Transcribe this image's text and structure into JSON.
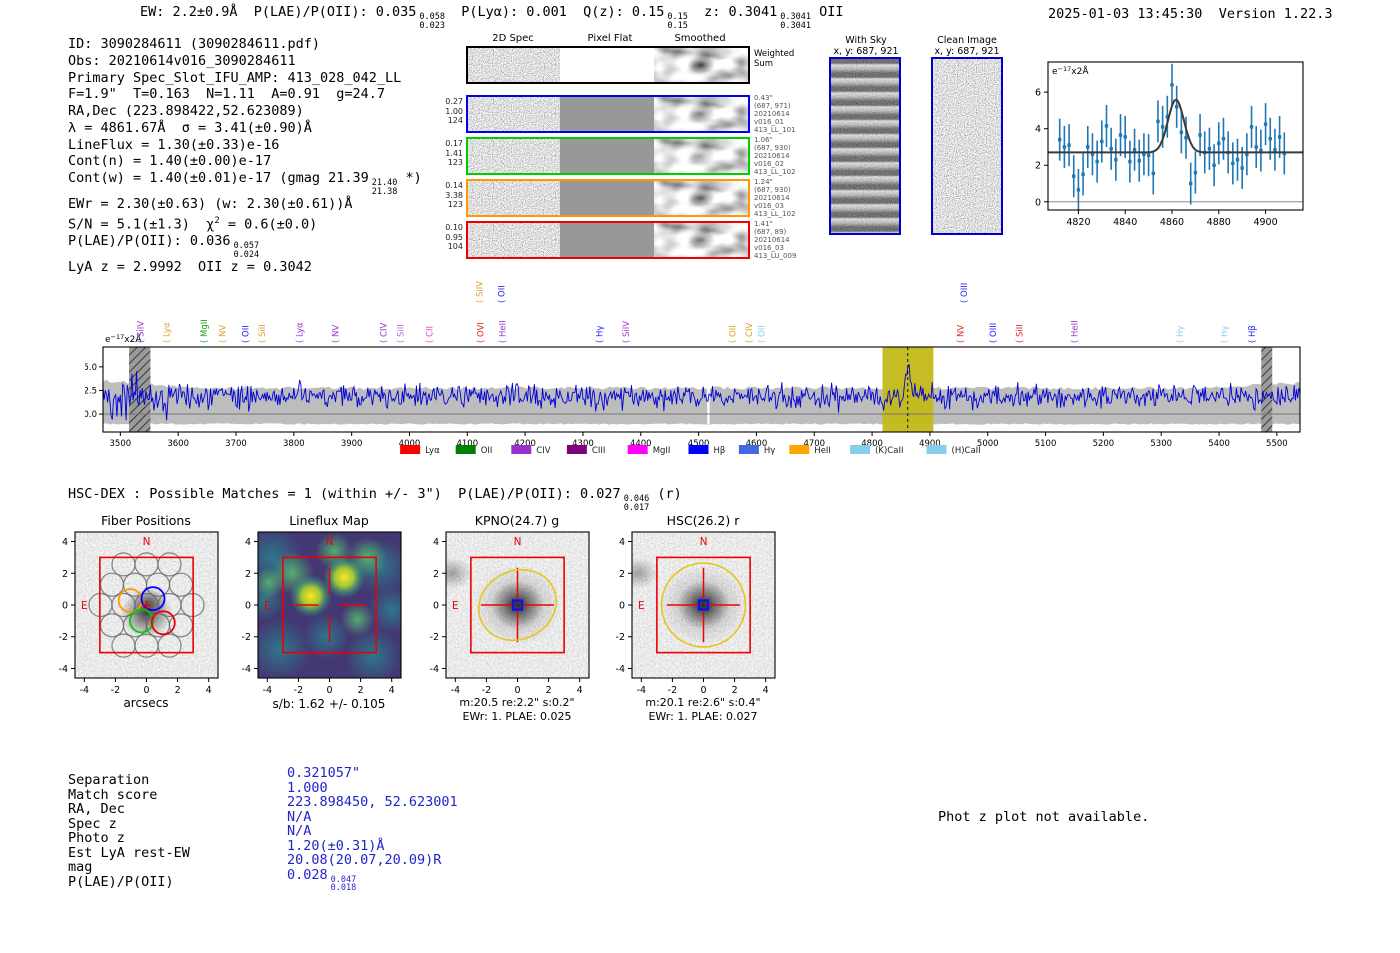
{
  "header": {
    "summary_segments": [
      {
        "t": "EW: 2.2±0.9Å  P(LAE)/P(OII): 0.035"
      },
      {
        "f": [
          "0.058",
          "0.023"
        ]
      },
      {
        "t": "  P(Lyα): 0.001  Q(z): 0.15"
      },
      {
        "f": [
          "0.15",
          "0.15"
        ]
      },
      {
        "t": "  z: 0.3041"
      },
      {
        "f": [
          "0.3041",
          "0.3041"
        ]
      },
      {
        "t": " OII"
      }
    ],
    "timestamp": "2025-01-03 13:45:30",
    "version": "Version 1.22.3"
  },
  "detection_info": {
    "lines": [
      [
        {
          "t": "ID: 3090284611 (3090284611.pdf)"
        }
      ],
      [
        {
          "t": "Obs: 20210614v016_3090284611"
        }
      ],
      [
        {
          "t": "Primary Spec_Slot_IFU_AMP: 413_028_042_LL"
        }
      ],
      [
        {
          "t": "F=1.9\"  T=0.163  N=1.11  A=0.91  g=24.7"
        }
      ],
      [
        {
          "t": "RA,Dec (223.898422,52.623089)"
        }
      ],
      [
        {
          "t": "λ = 4861.67Å  σ = 3.41(±0.90)Å"
        }
      ],
      [
        {
          "t": "LineFlux = 1.30(±0.33)e-16"
        }
      ],
      [
        {
          "t": "Cont(n) = 1.40(±0.00)e-17"
        }
      ],
      [
        {
          "t": "Cont(w) = 1.40(±0.01)e-17 (gmag 21.39"
        },
        {
          "f": [
            "21.40",
            "21.38"
          ]
        },
        {
          "t": " *)"
        }
      ],
      [
        {
          "t": "EWr = 2.30(±0.63) (w: 2.30(±0.61))Å"
        }
      ],
      [
        {
          "t": "S/N = 5.1(±1.3)  χ"
        },
        {
          "sup": "2"
        },
        {
          "t": " = 0.6(±0.0)"
        }
      ],
      [
        {
          "t": "P(LAE)/P(OII): 0.036"
        },
        {
          "f": [
            "0.057",
            "0.024"
          ]
        }
      ],
      [
        {
          "t": "LyA z = 2.9992  OII z = 0.3042"
        }
      ]
    ]
  },
  "spec2d": {
    "col_titles": [
      "2D Spec",
      "Pixel Flat",
      "Smoothed"
    ],
    "weighted_label": [
      "Weighted",
      "Sum"
    ],
    "rows": [
      {
        "color": "#0000ee",
        "left": [
          "0.27",
          "1.00",
          "124"
        ],
        "right": [
          "0.43\"",
          "(687, 971)",
          "20210614",
          "v016_01",
          "413_LL_101"
        ]
      },
      {
        "color": "#00cc00",
        "left": [
          "0.17",
          "1.41",
          "123"
        ],
        "right": [
          "1.06\"",
          "(687, 930)",
          "20210614",
          "v016_02",
          "413_LL_102"
        ]
      },
      {
        "color": "#ff9900",
        "left": [
          "0.14",
          "3.38",
          "123"
        ],
        "right": [
          "1.24\"",
          "(687, 930)",
          "20210614",
          "v016_03",
          "413_LL_102"
        ]
      },
      {
        "color": "#ee0000",
        "left": [
          "0.10",
          "0.95",
          "104"
        ],
        "right": [
          "1.41\"",
          "(687, 89)",
          "20210614",
          "v016_03",
          "413_LU_009"
        ]
      }
    ]
  },
  "panels": {
    "border_color": "#0000cc",
    "with_sky": {
      "title": "With Sky",
      "coords": "x, y: 687, 921"
    },
    "clean": {
      "title": "Clean Image",
      "coords": "x, y: 687, 921"
    }
  },
  "hsc_dex": {
    "segments": [
      {
        "t": "HSC-DEX : Possible Matches = 1 (within +/- 3\")  P(LAE)/P(OII): 0.027"
      },
      {
        "f": [
          "0.046",
          "0.017"
        ]
      },
      {
        "t": " (r)"
      }
    ]
  },
  "match_table": {
    "value_color": "#2323cc",
    "rows": [
      {
        "label": "Separation",
        "value": [
          {
            "t": "0.321057\""
          }
        ]
      },
      {
        "label": "Match score",
        "value": [
          {
            "t": "1.000"
          }
        ]
      },
      {
        "label": "RA, Dec",
        "value": [
          {
            "t": "223.898450, 52.623001"
          }
        ]
      },
      {
        "label": "Spec z",
        "value": [
          {
            "t": "N/A"
          }
        ]
      },
      {
        "label": "Photo z",
        "value": [
          {
            "t": "N/A"
          }
        ]
      },
      {
        "label": "Est LyA rest-EW",
        "value": [
          {
            "t": "1.20(±0.31)Å"
          }
        ]
      },
      {
        "label": "mag",
        "value": [
          {
            "t": "20.08(20.07,20.09)R"
          }
        ]
      },
      {
        "label": "P(LAE)/P(OII)",
        "value": [
          {
            "t": "0.028"
          },
          {
            "f": [
              "0.047",
              "0.018"
            ]
          }
        ]
      }
    ]
  },
  "footer": {
    "note": "Phot z plot not available."
  },
  "chart_data": [
    {
      "name": "line_fit_plot",
      "type": "scatter",
      "corner_label": {
        "pre": "e",
        "exp": "−17",
        "post": "x2Å"
      },
      "xlim": [
        4807,
        4916
      ],
      "ylim": [
        -0.45,
        7.65
      ],
      "xticks": [
        4820,
        4840,
        4860,
        4880,
        4900
      ],
      "yticks": [
        0,
        2,
        4,
        6
      ],
      "x": [
        4812,
        4814,
        4816,
        4818,
        4820,
        4822,
        4824,
        4826,
        4828,
        4830,
        4832,
        4834,
        4836,
        4838,
        4840,
        4842,
        4844,
        4846,
        4848,
        4850,
        4852,
        4854,
        4856,
        4858,
        4860,
        4862,
        4864,
        4866,
        4868,
        4870,
        4872,
        4874,
        4876,
        4878,
        4880,
        4882,
        4884,
        4886,
        4888,
        4890,
        4892,
        4894,
        4896,
        4898,
        4900,
        4902,
        4904,
        4906,
        4908
      ],
      "y": [
        3.4,
        3.0,
        3.1,
        1.4,
        0.65,
        1.5,
        3.0,
        2.6,
        2.2,
        3.3,
        4.15,
        2.9,
        2.3,
        3.65,
        3.55,
        2.2,
        2.85,
        2.25,
        2.6,
        2.55,
        1.55,
        4.4,
        4.1,
        4.65,
        6.4,
        5.2,
        3.8,
        3.5,
        1.0,
        1.6,
        3.65,
        2.7,
        2.9,
        2.0,
        3.2,
        3.45,
        2.7,
        2.1,
        2.3,
        1.85,
        2.6,
        4.1,
        3.0,
        2.8,
        4.25,
        3.45,
        2.85,
        3.55,
        2.65
      ],
      "yerr": 1.15,
      "fit": {
        "baseline": 2.7,
        "amplitude": 2.9,
        "center": 4861.7,
        "sigma": 3.4
      },
      "point_color": "#1f77b4",
      "fit_color": "#3a3a3a"
    },
    {
      "name": "full_spectrum",
      "type": "line",
      "corner_label": {
        "pre": "e",
        "exp": "−17",
        "post": "x2Å"
      },
      "xlim": [
        3470,
        5540
      ],
      "ylim": [
        -1.9,
        7.1
      ],
      "xticks": [
        3500,
        3600,
        3700,
        3800,
        3900,
        4000,
        4100,
        4200,
        4300,
        4400,
        4500,
        4600,
        4700,
        4800,
        4900,
        5000,
        5100,
        5200,
        5300,
        5400,
        5500
      ],
      "yticks": [
        0.0,
        2.5,
        5.0
      ],
      "line_color": "#0000d8",
      "spectrum": {
        "baseline": 1.85,
        "noise_sigma": 0.95,
        "edge_noise_boost": 2.0,
        "peak": {
          "center": 4861.7,
          "amplitude": 3.3,
          "sigma": 3.3
        }
      },
      "error_band": {
        "top": 2.75,
        "bottom": -1.05,
        "color": "#bdbdbd"
      },
      "highlight_band": {
        "x0": 4818,
        "x1": 4906,
        "color": "#c3b918"
      },
      "marker_line": {
        "x": 4861.67,
        "color": "#111111"
      },
      "hatch_bands": [
        [
          3515,
          3552
        ],
        [
          5473,
          5492
        ]
      ],
      "gap_x": 4517,
      "line_labels": [
        {
          "label": "SiIV",
          "color": "#9932cc",
          "wave": 3540,
          "row": "low"
        },
        {
          "label": "Lyα",
          "color": "#dd9f2b",
          "wave": 3585,
          "row": "low"
        },
        {
          "label": "MgII",
          "color": "#1e9e1e",
          "wave": 3650,
          "row": "low"
        },
        {
          "label": "NV",
          "color": "#dd9f2b",
          "wave": 3682,
          "row": "low"
        },
        {
          "label": "OII",
          "color": "#2222ee",
          "wave": 3722,
          "row": "low"
        },
        {
          "label": "SiII",
          "color": "#dd9f2b",
          "wave": 3750,
          "row": "low"
        },
        {
          "label": "Lyα",
          "color": "#9932cc",
          "wave": 3815,
          "row": "low"
        },
        {
          "label": "NV",
          "color": "#9932cc",
          "wave": 3877,
          "row": "low"
        },
        {
          "label": "CIV",
          "color": "#9932cc",
          "wave": 3960,
          "row": "low"
        },
        {
          "label": "SiII",
          "color": "#b06fd8",
          "wave": 3990,
          "row": "low"
        },
        {
          "label": "CII",
          "color": "#ee44cc",
          "wave": 4040,
          "row": "low"
        },
        {
          "label": "SiIV",
          "color": "#dd9f2b",
          "wave": 4126,
          "row": "high"
        },
        {
          "label": "OII",
          "color": "#2222ee",
          "wave": 4164,
          "row": "high"
        },
        {
          "label": "OVI",
          "color": "#dd2222",
          "wave": 4128,
          "row": "low"
        },
        {
          "label": "HeII",
          "color": "#9932cc",
          "wave": 4166,
          "row": "low"
        },
        {
          "label": "Hγ",
          "color": "#2222ee",
          "wave": 4334,
          "row": "low"
        },
        {
          "label": "SiIV",
          "color": "#9932cc",
          "wave": 4380,
          "row": "low"
        },
        {
          "label": "OII",
          "color": "#dd9f2b",
          "wave": 4564,
          "row": "low"
        },
        {
          "label": "CIV",
          "color": "#dd9f2b",
          "wave": 4592,
          "row": "low"
        },
        {
          "label": "OII",
          "color": "#86ceea",
          "wave": 4614,
          "row": "low"
        },
        {
          "label": "OIII",
          "color": "#2222ee",
          "wave": 4964,
          "row": "high"
        },
        {
          "label": "NV",
          "color": "#dd2222",
          "wave": 4958,
          "row": "low"
        },
        {
          "label": "OIII",
          "color": "#2222ee",
          "wave": 5014,
          "row": "low"
        },
        {
          "label": "SiII",
          "color": "#dd2222",
          "wave": 5060,
          "row": "low"
        },
        {
          "label": "HeII",
          "color": "#9932cc",
          "wave": 5155,
          "row": "low"
        },
        {
          "label": "Hγ",
          "color": "#86ceea",
          "wave": 5338,
          "row": "low"
        },
        {
          "label": "Hγ",
          "color": "#86ceea",
          "wave": 5415,
          "row": "low"
        },
        {
          "label": "Hβ",
          "color": "#2222ee",
          "wave": 5462,
          "row": "low"
        }
      ],
      "legend": [
        {
          "label": "Lyα",
          "color": "#ff0000"
        },
        {
          "label": "OII",
          "color": "#008000"
        },
        {
          "label": "CIV",
          "color": "#9932cc"
        },
        {
          "label": "CIII",
          "color": "#800080"
        },
        {
          "label": "MgII",
          "color": "#ff00ff"
        },
        {
          "label": "Hβ",
          "color": "#0000ff"
        },
        {
          "label": "Hγ",
          "color": "#4169e1"
        },
        {
          "label": "HeII",
          "color": "#ffa500"
        },
        {
          "label": "(K)CaII",
          "color": "#87ceeb"
        },
        {
          "label": "(H)CaII",
          "color": "#87ceeb"
        }
      ]
    },
    {
      "name": "fiber_positions",
      "type": "image",
      "title": "Fiber Positions",
      "xlabel": "arcsecs",
      "ticks": [
        -4,
        -2,
        0,
        2,
        4
      ],
      "lim": [
        -4.6,
        4.6
      ],
      "compass_n": "N",
      "compass_e": "E",
      "aperture_box": [
        -3,
        3
      ],
      "fibers": {
        "spacing": 1.48,
        "radius": 0.74
      },
      "colored_fibers": [
        {
          "color": "#ff9900",
          "x": -1.05,
          "y": 0.28
        },
        {
          "color": "#0000ff",
          "x": 0.42,
          "y": 0.4
        },
        {
          "color": "#00cc00",
          "x": -0.32,
          "y": -1.0
        },
        {
          "color": "#ee0000",
          "x": 1.08,
          "y": -1.12
        }
      ]
    },
    {
      "name": "lineflux_map",
      "type": "image",
      "title": "Lineflux Map",
      "sublabel": "s/b: 1.62 +/- 0.105",
      "ticks": [
        -4,
        -2,
        0,
        2,
        4
      ],
      "lim": [
        -4.6,
        4.6
      ],
      "compass_n": "N",
      "compass_e": "E",
      "aperture_box": [
        -3,
        3
      ],
      "hotspots": [
        {
          "x": -1.2,
          "y": 0.55
        },
        {
          "x": 0.95,
          "y": 1.75
        }
      ]
    },
    {
      "name": "kpno_g",
      "type": "image",
      "title": "KPNO(24.7) g",
      "line1": "m:20.5 re:2.2\" s:0.2\"",
      "line2": "EWr: 1. PLAE: 0.025",
      "ticks": [
        -4,
        -2,
        0,
        2,
        4
      ],
      "lim": [
        -4.6,
        4.6
      ],
      "compass_n": "N",
      "compass_e": "E",
      "aperture_box": [
        -3,
        3
      ],
      "aperture_ellipse": {
        "rx": 2.55,
        "ry": 2.15,
        "angle": -25,
        "color": "#e6c619"
      }
    },
    {
      "name": "hsc_r",
      "type": "image",
      "title": "HSC(26.2) r",
      "line1": "m:20.1 re:2.6\" s:0.4\"",
      "line2": "EWr: 1. PLAE: 0.027",
      "ticks": [
        -4,
        -2,
        0,
        2,
        4
      ],
      "lim": [
        -4.6,
        4.6
      ],
      "compass_n": "N",
      "compass_e": "E",
      "aperture_box": [
        -3,
        3
      ],
      "aperture_circle": {
        "r": 2.7,
        "color": "#e6c619"
      }
    }
  ]
}
